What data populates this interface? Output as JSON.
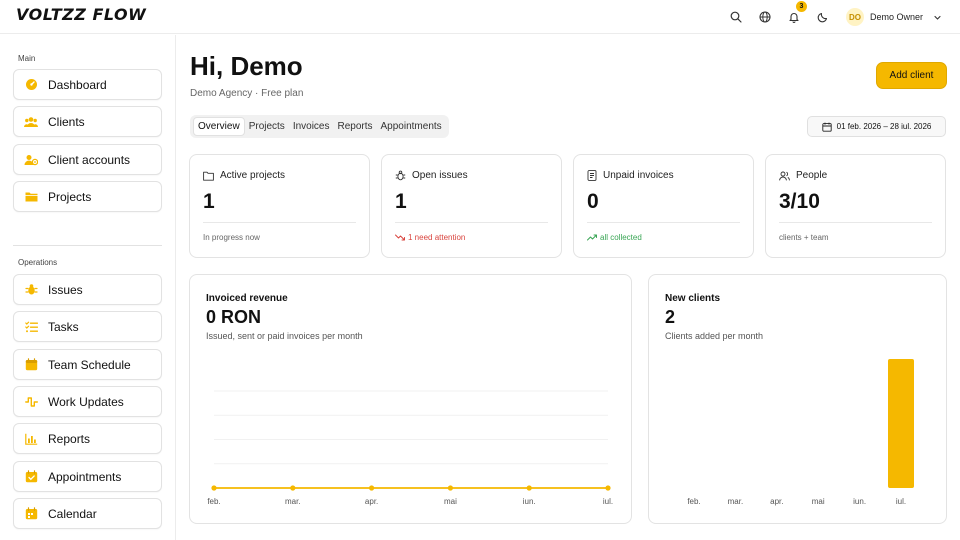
{
  "app": {
    "logo": "VOLTZZ FLOW"
  },
  "header": {
    "notifications_count": "3",
    "user": {
      "initials": "DO",
      "name": "Demo Owner"
    }
  },
  "sidebar": {
    "sections": [
      {
        "title": "Main",
        "items": [
          {
            "label": "Dashboard",
            "icon": "dashboard-icon"
          },
          {
            "label": "Clients",
            "icon": "users-icon"
          },
          {
            "label": "Client accounts",
            "icon": "client-accounts-icon"
          },
          {
            "label": "Projects",
            "icon": "folder-icon"
          }
        ]
      },
      {
        "title": "Operations",
        "items": [
          {
            "label": "Issues",
            "icon": "bug-icon"
          },
          {
            "label": "Tasks",
            "icon": "tasks-icon"
          },
          {
            "label": "Team Schedule",
            "icon": "schedule-icon"
          },
          {
            "label": "Work Updates",
            "icon": "work-updates-icon"
          },
          {
            "label": "Reports",
            "icon": "bar-chart-icon"
          },
          {
            "label": "Appointments",
            "icon": "calendar-check-icon"
          },
          {
            "label": "Calendar",
            "icon": "calendar-icon"
          }
        ]
      }
    ]
  },
  "main": {
    "greeting": "Hi, Demo",
    "agency": "Demo Agency · Free plan",
    "add_client_label": "Add client",
    "tabs": [
      "Overview",
      "Projects",
      "Invoices",
      "Reports",
      "Appointments"
    ],
    "active_tab": "Overview",
    "date_range": "01 feb. 2026 – 28 iul. 2026",
    "stats": [
      {
        "label": "Active projects",
        "value": "1",
        "foot": "In progress now",
        "icon": "folder-outline-icon"
      },
      {
        "label": "Open issues",
        "value": "1",
        "foot": "1 need attention",
        "icon": "bug-outline-icon",
        "foot_color": "#d9453f"
      },
      {
        "label": "Unpaid invoices",
        "value": "0",
        "foot": "all collected",
        "icon": "invoice-icon",
        "foot_color": "#3aa655"
      },
      {
        "label": "People",
        "value": "3/10",
        "foot": "clients + team",
        "icon": "people-icon"
      }
    ],
    "revenue_chart": {
      "title": "Invoiced revenue",
      "value": "0 RON",
      "subtitle": "Issued, sent or paid invoices per month"
    },
    "clients_chart": {
      "title": "New clients",
      "value": "2",
      "subtitle": "Clients added per month"
    }
  },
  "chart_data": [
    {
      "type": "line",
      "title": "Invoiced revenue",
      "categories": [
        "feb.",
        "mar.",
        "apr.",
        "mai",
        "iun.",
        "iul."
      ],
      "series": [
        {
          "values": [
            0,
            0,
            0,
            0,
            0,
            0
          ]
        }
      ],
      "ylim": [
        0,
        4
      ],
      "grid": true,
      "color": "#f5b800"
    },
    {
      "type": "bar",
      "title": "New clients",
      "categories": [
        "feb.",
        "mar.",
        "apr.",
        "mai",
        "iun.",
        "iul."
      ],
      "values": [
        0,
        0,
        0,
        0,
        0,
        2
      ],
      "ylim": [
        0,
        2
      ],
      "grid": false,
      "color": "#f5b800"
    }
  ],
  "colors": {
    "accent": "#f5b800",
    "danger": "#d9453f",
    "success": "#3aa655"
  }
}
